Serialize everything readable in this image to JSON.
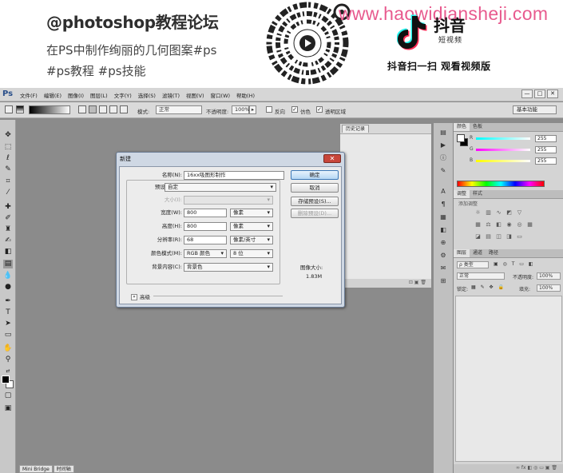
{
  "banner": {
    "title": "@photoshop教程论坛",
    "subtitle_line1": "在PS中制作绚丽的几何图案#ps",
    "subtitle_line2": "#ps教程 #ps技能",
    "watermark": "www.haowidiansheji.com",
    "douyin_title": "抖音",
    "douyin_sub": "短视频",
    "scan_tip": "抖音扫一扫 观看视频版"
  },
  "app": {
    "logo": "Ps",
    "menus": [
      "文件(F)",
      "编辑(E)",
      "图像(I)",
      "图层(L)",
      "文字(Y)",
      "选择(S)",
      "滤镜(T)",
      "视图(V)",
      "窗口(W)",
      "帮助(H)"
    ],
    "window_buttons": [
      "—",
      "□",
      "✕"
    ],
    "options": {
      "mode_label": "模式:",
      "mode_value": "正常",
      "opacity_label": "不透明度:",
      "opacity_value": "100%",
      "reverse": "反向",
      "dither": "仿色",
      "transparency": "透明区域",
      "workspace": "基本功能"
    },
    "history_panel": {
      "tab": "历史记录"
    },
    "color_panel": {
      "tabs": [
        "颜色",
        "色板"
      ],
      "channels": [
        {
          "name": "R",
          "value": "255"
        },
        {
          "name": "G",
          "value": "255"
        },
        {
          "name": "B",
          "value": "255"
        }
      ]
    },
    "adjust_panel": {
      "tabs": [
        "调整",
        "样式"
      ],
      "label": "添加调整"
    },
    "layers_panel": {
      "tabs": [
        "图层",
        "通道",
        "路径"
      ],
      "filter": "ρ 类型",
      "blend": "正常",
      "opacity_label": "不透明度:",
      "opacity_value": "100%",
      "lock_label": "锁定:",
      "fill_label": "填充:",
      "fill_value": "100%"
    },
    "statusbar": [
      "Mini Bridge",
      "时间轴"
    ]
  },
  "dialog": {
    "title": "新建",
    "close": "✕",
    "name_label": "名称(N):",
    "name_value": "16xx吸图形制作",
    "preset_label": "预设(P):",
    "preset_value": "自定",
    "size_label": "大小(I):",
    "size_value": "",
    "width_label": "宽度(W):",
    "width_value": "800",
    "width_unit": "像素",
    "height_label": "高度(H):",
    "height_value": "800",
    "height_unit": "像素",
    "resolution_label": "分辨率(R):",
    "resolution_value": "68",
    "resolution_unit": "像素/英寸",
    "colormode_label": "颜色模式(M):",
    "colormode_value": "RGB 颜色",
    "bitdepth_value": "8 位",
    "background_label": "背景内容(C):",
    "background_value": "背景色",
    "advanced": "高级",
    "buttons": {
      "ok": "确定",
      "cancel": "取消",
      "save_preset": "存储预设(S)...",
      "delete_preset": "删除预设(D)..."
    },
    "image_size_label": "图像大小:",
    "image_size_value": "1.83M"
  }
}
